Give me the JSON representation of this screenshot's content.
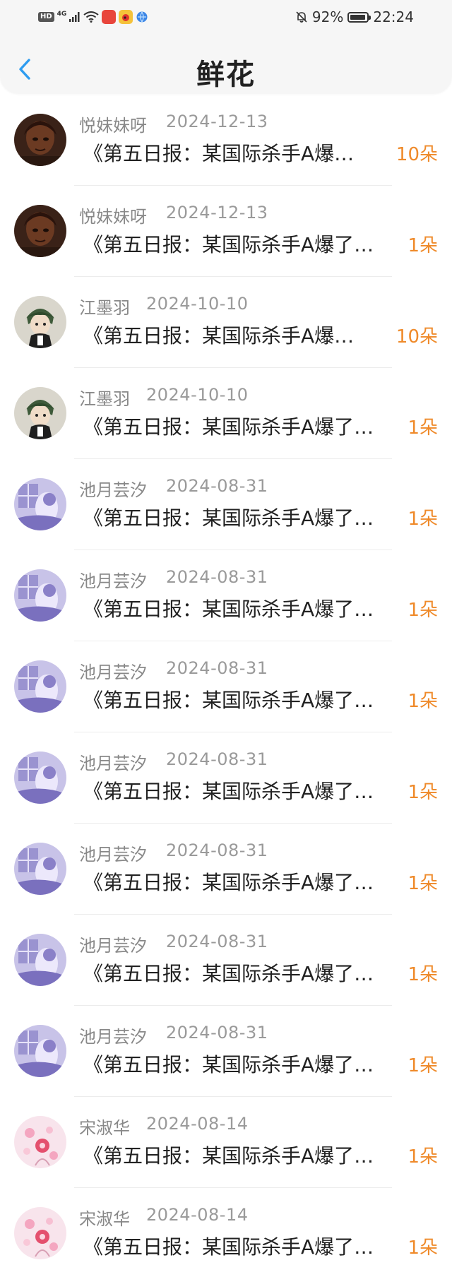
{
  "status_bar": {
    "hd": "HD",
    "network": "4G",
    "battery_percent": "92%",
    "battery_level": 0.92,
    "time": "22:24"
  },
  "header": {
    "title": "鲜花"
  },
  "colors": {
    "accent": "#2e9cf0",
    "count": "#ef8a2a"
  },
  "items": [
    {
      "user": "悦妹妹呀",
      "date": "2024-12-13",
      "article": "《第五日报：某国际杀手A爆…",
      "count": "10朵",
      "avatar": "dark-portrait"
    },
    {
      "user": "悦妹妹呀",
      "date": "2024-12-13",
      "article": "《第五日报：某国际杀手A爆了…",
      "count": "1朵",
      "avatar": "dark-portrait"
    },
    {
      "user": "江墨羽",
      "date": "2024-10-10",
      "article": "《第五日报：某国际杀手A爆…",
      "count": "10朵",
      "avatar": "green-hair-character"
    },
    {
      "user": "江墨羽",
      "date": "2024-10-10",
      "article": "《第五日报：某国际杀手A爆了…",
      "count": "1朵",
      "avatar": "green-hair-character"
    },
    {
      "user": "池月芸汐",
      "date": "2024-08-31",
      "article": "《第五日报：某国际杀手A爆了…",
      "count": "1朵",
      "avatar": "purple-illustration"
    },
    {
      "user": "池月芸汐",
      "date": "2024-08-31",
      "article": "《第五日报：某国际杀手A爆了…",
      "count": "1朵",
      "avatar": "purple-illustration"
    },
    {
      "user": "池月芸汐",
      "date": "2024-08-31",
      "article": "《第五日报：某国际杀手A爆了…",
      "count": "1朵",
      "avatar": "purple-illustration"
    },
    {
      "user": "池月芸汐",
      "date": "2024-08-31",
      "article": "《第五日报：某国际杀手A爆了…",
      "count": "1朵",
      "avatar": "purple-illustration"
    },
    {
      "user": "池月芸汐",
      "date": "2024-08-31",
      "article": "《第五日报：某国际杀手A爆了…",
      "count": "1朵",
      "avatar": "purple-illustration"
    },
    {
      "user": "池月芸汐",
      "date": "2024-08-31",
      "article": "《第五日报：某国际杀手A爆了…",
      "count": "1朵",
      "avatar": "purple-illustration"
    },
    {
      "user": "池月芸汐",
      "date": "2024-08-31",
      "article": "《第五日报：某国际杀手A爆了…",
      "count": "1朵",
      "avatar": "purple-illustration"
    },
    {
      "user": "宋淑华",
      "date": "2024-08-14",
      "article": "《第五日报：某国际杀手A爆了…",
      "count": "1朵",
      "avatar": "pink-floral"
    },
    {
      "user": "宋淑华",
      "date": "2024-08-14",
      "article": "《第五日报：某国际杀手A爆了…",
      "count": "1朵",
      "avatar": "pink-floral"
    }
  ]
}
